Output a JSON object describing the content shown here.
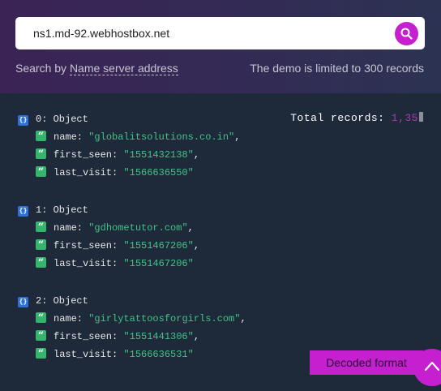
{
  "search": {
    "value": "ns1.md-92.webhostbox.net",
    "search_by_prefix": "Search by ",
    "search_by_link": "Name server address",
    "demo_limit": "The demo is limited to 300 records"
  },
  "results": {
    "total_label": "Total records: ",
    "total_value": "1,35",
    "records": [
      {
        "header": "0: Object",
        "fields": [
          {
            "key": "name:",
            "value": "\"globalitsolutions.co.in\"",
            "comma": ","
          },
          {
            "key": "first_seen:",
            "value": "\"1551432138\"",
            "comma": ","
          },
          {
            "key": "last_visit:",
            "value": "\"1566636550\"",
            "comma": ""
          }
        ]
      },
      {
        "header": "1: Object",
        "fields": [
          {
            "key": "name:",
            "value": "\"gdhometutor.com\"",
            "comma": ","
          },
          {
            "key": "first_seen:",
            "value": "\"1551467206\"",
            "comma": ","
          },
          {
            "key": "last_visit:",
            "value": "\"1551467206\"",
            "comma": ""
          }
        ]
      },
      {
        "header": "2: Object",
        "fields": [
          {
            "key": "name:",
            "value": "\"girlytattoosforgirls.com\"",
            "comma": ","
          },
          {
            "key": "first_seen:",
            "value": "\"1551441306\"",
            "comma": ","
          },
          {
            "key": "last_visit:",
            "value": "\"1566636531\"",
            "comma": ""
          }
        ]
      }
    ]
  },
  "icons": {
    "object_icon_glyph": "{}",
    "string_icon_glyph": "“"
  },
  "buttons": {
    "decoded_format": "Decoded format"
  },
  "colors": {
    "accent": "#c51fd0",
    "string_value": "#3fc389",
    "object_icon": "#2e6fd8",
    "string_icon": "#36b36c"
  }
}
